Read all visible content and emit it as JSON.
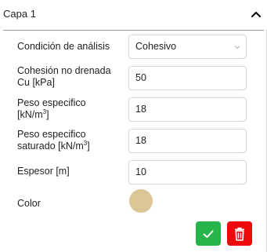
{
  "panel": {
    "title": "Capa 1"
  },
  "form": {
    "analysis_condition": {
      "label": "Condición de análisis",
      "value": "Cohesivo"
    },
    "undrained_cohesion": {
      "label_line1": "Cohesión no drenada",
      "label_line2": "Cu [kPa]",
      "value": "50"
    },
    "specific_weight": {
      "label_line1": "Peso especifico",
      "label_line2_prefix": "[kN/m",
      "label_line2_sup": "3",
      "label_line2_suffix": "]",
      "value": "18"
    },
    "saturated_weight": {
      "label_line1": "Peso especifico",
      "label_line2_prefix": "saturado [kN/m",
      "label_line2_sup": "3",
      "label_line2_suffix": "]",
      "value": "18"
    },
    "thickness": {
      "label": "Espesor [m]",
      "value": "10"
    },
    "color": {
      "label": "Color",
      "value": "#dcc596"
    }
  },
  "icons": {
    "collapse": "chevron-up-icon",
    "select": "chevron-down-icon",
    "confirm": "check-icon",
    "delete": "trash-icon"
  },
  "colors": {
    "confirm_button": "#27b44b",
    "delete_button": "#ee0b0b"
  }
}
